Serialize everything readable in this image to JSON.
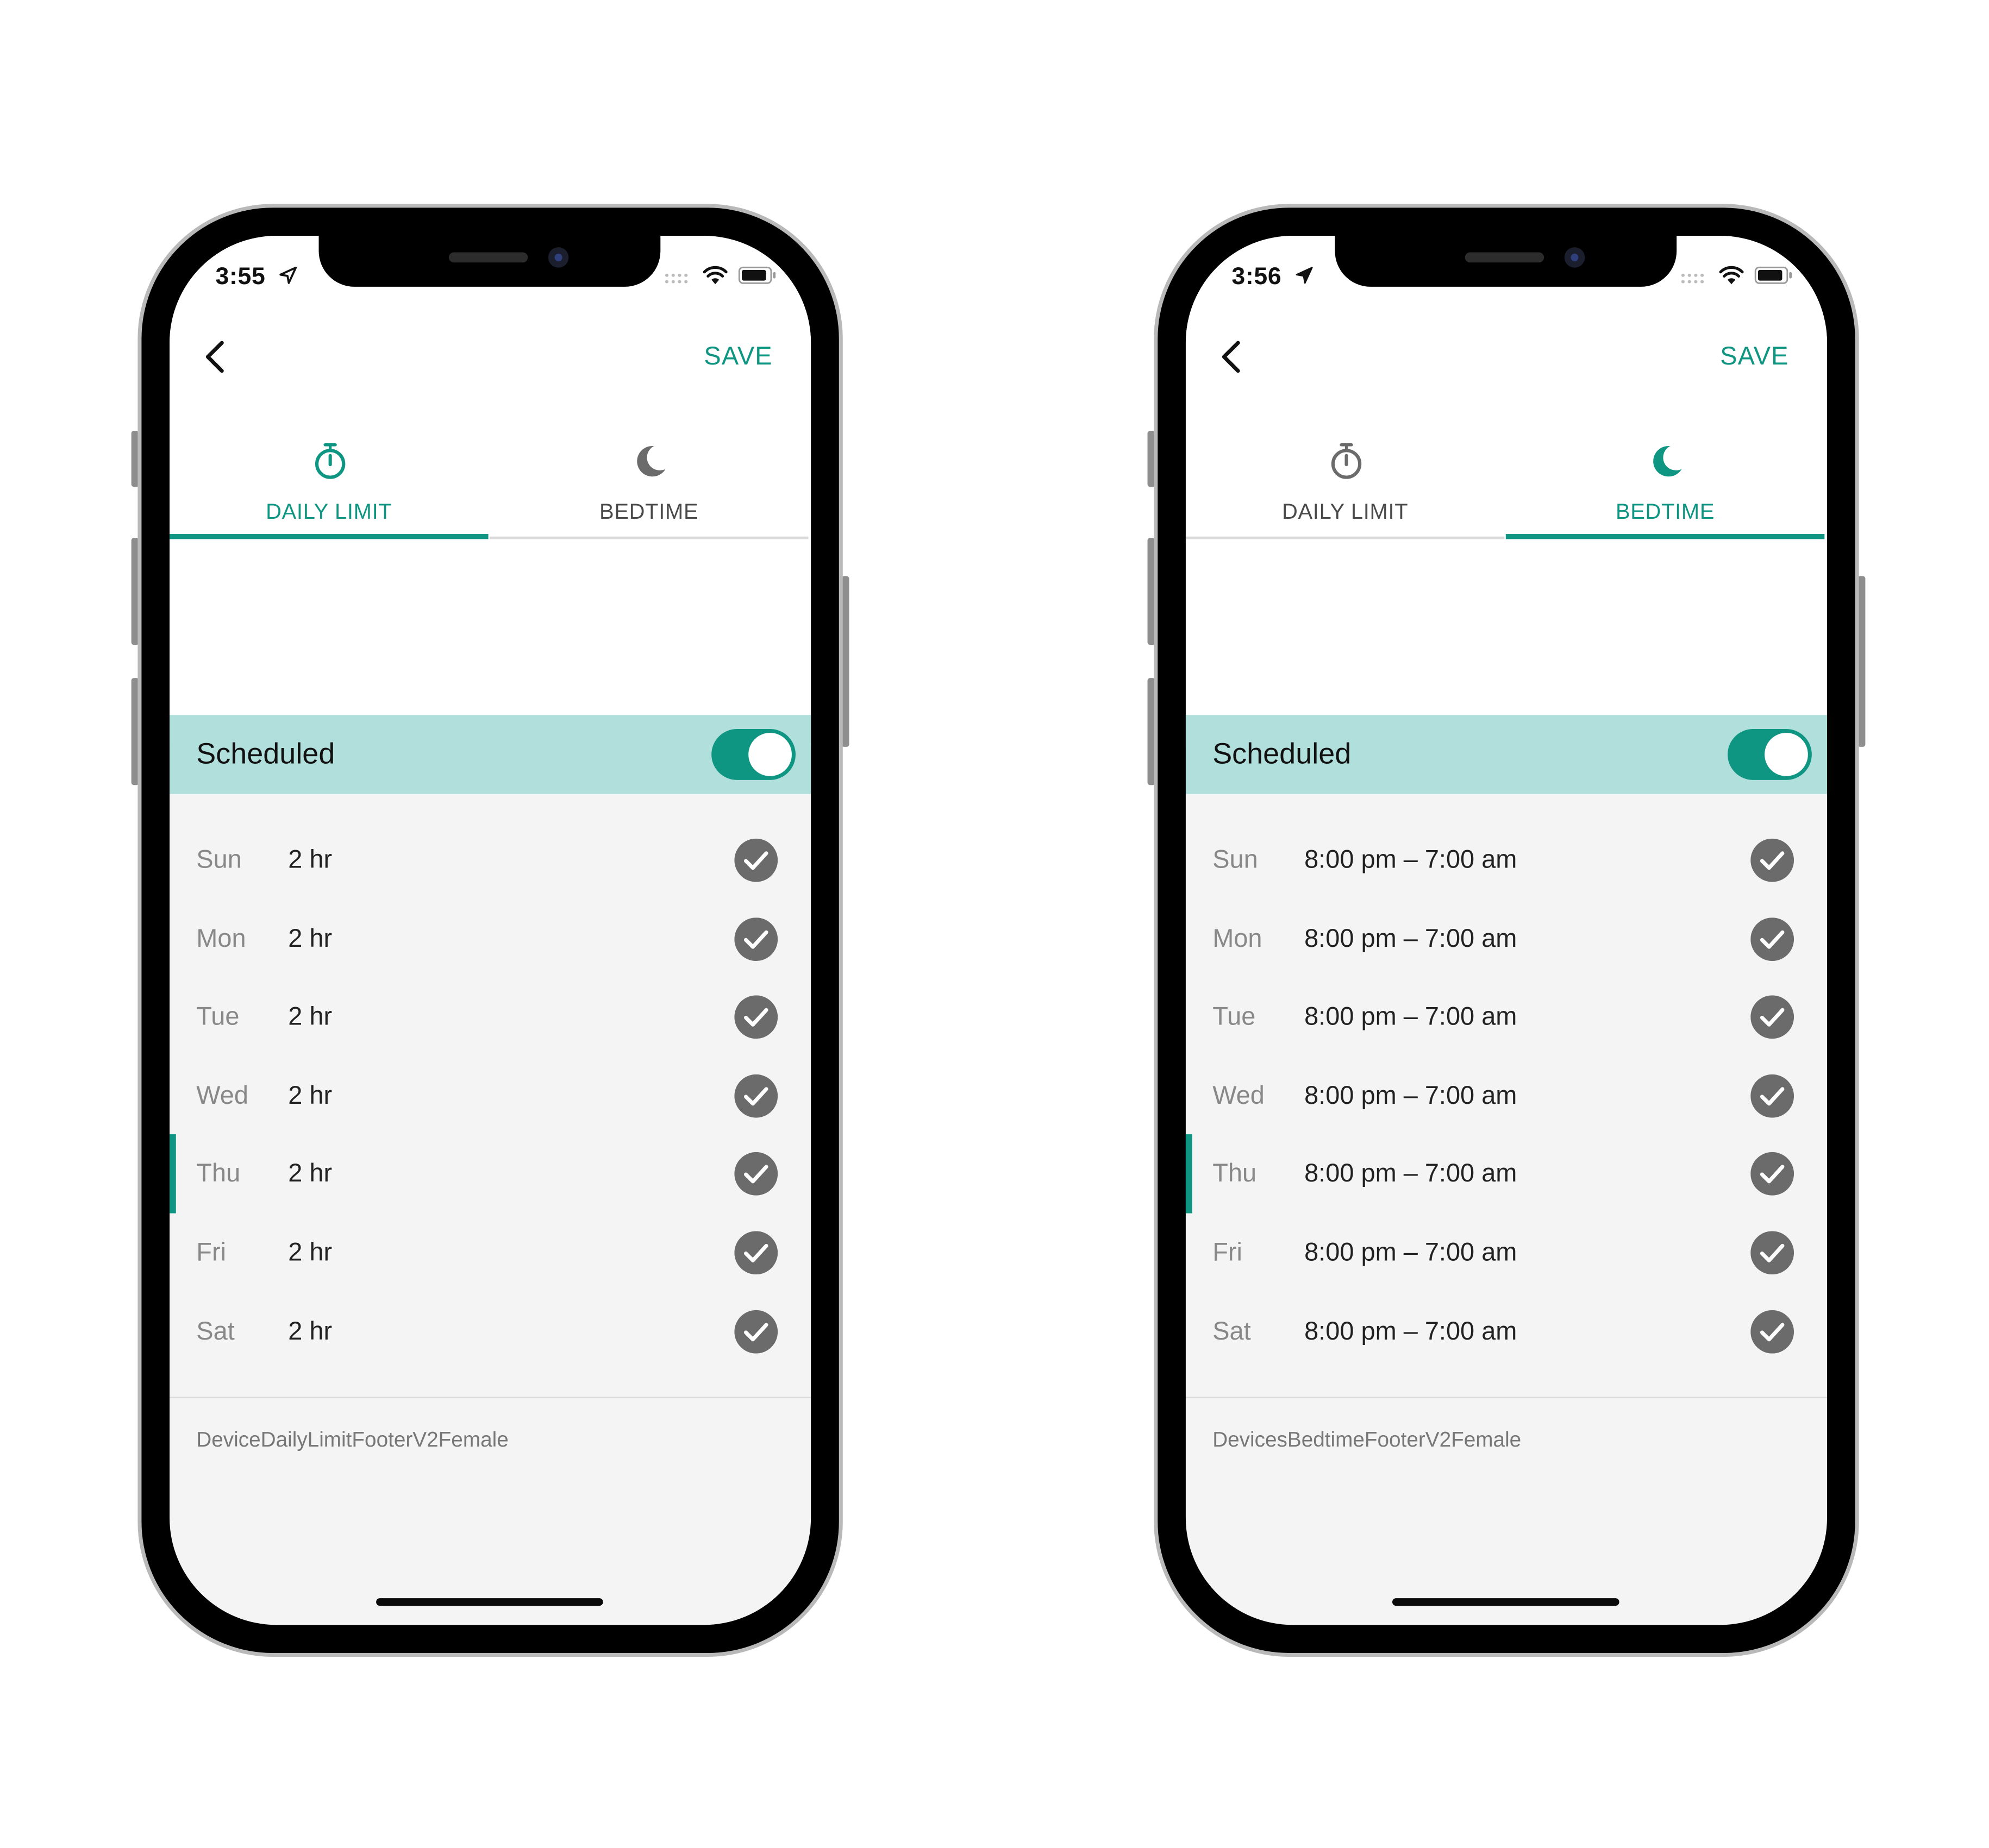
{
  "colors": {
    "accent": "#0f9683",
    "scheduled_bar": "#b1dfdb",
    "check": "#6b6b6b"
  },
  "phones": [
    {
      "status": {
        "time": "3:55",
        "icons": [
          "location-arrow-icon",
          "cellular-signal-icon",
          "wifi-icon",
          "battery-icon"
        ]
      },
      "header": {
        "save_label": "SAVE"
      },
      "tabs": [
        {
          "label": "DAILY LIMIT",
          "icon": "stopwatch-icon",
          "active": true
        },
        {
          "label": "BEDTIME",
          "icon": "moon-icon",
          "active": false
        }
      ],
      "scheduled": {
        "label": "Scheduled",
        "on": true
      },
      "rows": [
        {
          "day": "Sun",
          "value": "2 hr",
          "checked": true
        },
        {
          "day": "Mon",
          "value": "2 hr",
          "checked": true
        },
        {
          "day": "Tue",
          "value": "2 hr",
          "checked": true
        },
        {
          "day": "Wed",
          "value": "2 hr",
          "checked": true
        },
        {
          "day": "Thu",
          "value": "2 hr",
          "checked": true,
          "current": true
        },
        {
          "day": "Fri",
          "value": "2 hr",
          "checked": true
        },
        {
          "day": "Sat",
          "value": "2 hr",
          "checked": true
        }
      ],
      "footer": "DeviceDailyLimitFooterV2Female"
    },
    {
      "status": {
        "time": "3:56",
        "icons": [
          "location-arrow-icon",
          "cellular-signal-icon",
          "wifi-icon",
          "battery-icon"
        ]
      },
      "header": {
        "save_label": "SAVE"
      },
      "tabs": [
        {
          "label": "DAILY LIMIT",
          "icon": "stopwatch-icon",
          "active": false
        },
        {
          "label": "BEDTIME",
          "icon": "moon-icon",
          "active": true
        }
      ],
      "scheduled": {
        "label": "Scheduled",
        "on": true
      },
      "rows": [
        {
          "day": "Sun",
          "value": "8:00 pm – 7:00 am",
          "checked": true
        },
        {
          "day": "Mon",
          "value": "8:00 pm – 7:00 am",
          "checked": true
        },
        {
          "day": "Tue",
          "value": "8:00 pm – 7:00 am",
          "checked": true
        },
        {
          "day": "Wed",
          "value": "8:00 pm – 7:00 am",
          "checked": true
        },
        {
          "day": "Thu",
          "value": "8:00 pm – 7:00 am",
          "checked": true,
          "current": true
        },
        {
          "day": "Fri",
          "value": "8:00 pm – 7:00 am",
          "checked": true
        },
        {
          "day": "Sat",
          "value": "8:00 pm – 7:00 am",
          "checked": true
        }
      ],
      "footer": "DevicesBedtimeFooterV2Female"
    }
  ]
}
